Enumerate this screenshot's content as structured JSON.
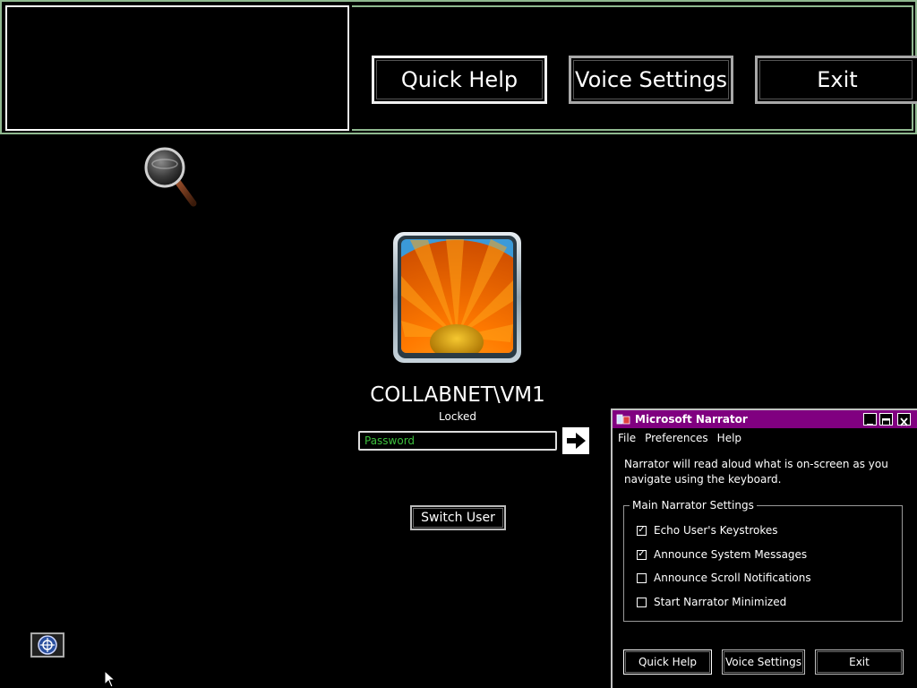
{
  "magnifier_toolbar": {
    "quick_help": "Quick Help",
    "voice_settings": "Voice Settings",
    "exit": "Exit"
  },
  "login": {
    "username": "COLLABNET\\VM1",
    "status": "Locked",
    "password_placeholder": "Password",
    "switch_user": "Switch User"
  },
  "narrator": {
    "title": "Microsoft Narrator",
    "menu": [
      "File",
      "Preferences",
      "Help"
    ],
    "description": "Narrator will read aloud what is on-screen as you navigate using the keyboard.",
    "group_title": "Main Narrator Settings",
    "options": [
      {
        "label": "Echo User's Keystrokes",
        "checked": true
      },
      {
        "label": "Announce System Messages",
        "checked": true
      },
      {
        "label": "Announce Scroll Notifications",
        "checked": false
      },
      {
        "label": "Start Narrator Minimized",
        "checked": false
      }
    ],
    "buttons": {
      "quick_help": "Quick Help",
      "voice_settings": "Voice Settings",
      "exit": "Exit"
    },
    "title_color": "#800080"
  },
  "icons": {
    "magnifier": "magnifier-icon",
    "submit": "arrow-right-icon",
    "ease_of_access": "ease-of-access-icon",
    "cursor": "mouse-pointer-icon"
  }
}
